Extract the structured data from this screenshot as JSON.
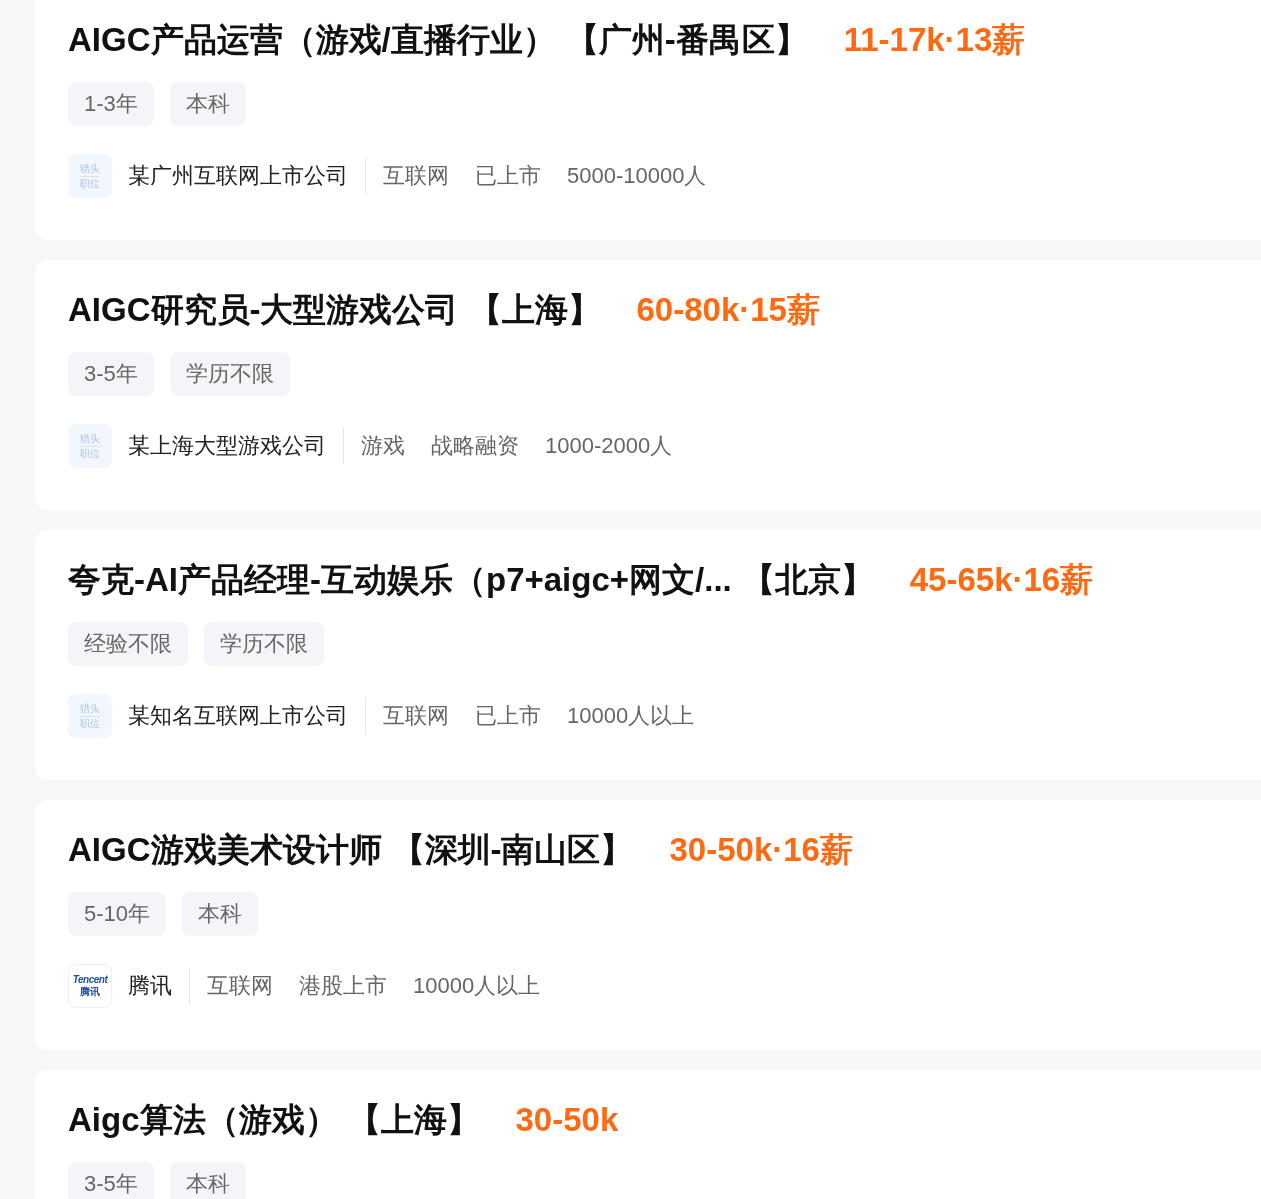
{
  "jobs": [
    {
      "name": "AIGC产品运营（游戏/直播行业）",
      "location": "【广州-番禺区】",
      "salary": "11-17k·13薪",
      "tags": [
        "1-3年",
        "本科"
      ],
      "company": {
        "logo": {
          "kind": "headhunter",
          "lines": [
            "猎头",
            "职位"
          ]
        },
        "name": "某广州互联网上市公司",
        "details": [
          "互联网",
          "已上市",
          "5000-10000人"
        ]
      }
    },
    {
      "name": "AIGC研究员-大型游戏公司",
      "location": "【上海】",
      "salary": "60-80k·15薪",
      "tags": [
        "3-5年",
        "学历不限"
      ],
      "company": {
        "logo": {
          "kind": "headhunter",
          "lines": [
            "猎头",
            "职位"
          ]
        },
        "name": "某上海大型游戏公司",
        "details": [
          "游戏",
          "战略融资",
          "1000-2000人"
        ]
      }
    },
    {
      "name": "夸克-AI产品经理-互动娱乐（p7+aigc+网文/...",
      "location": "【北京】",
      "salary": "45-65k·16薪",
      "tags": [
        "经验不限",
        "学历不限"
      ],
      "company": {
        "logo": {
          "kind": "headhunter",
          "lines": [
            "猎头",
            "职位"
          ]
        },
        "name": "某知名互联网上市公司",
        "details": [
          "互联网",
          "已上市",
          "10000人以上"
        ]
      }
    },
    {
      "name": "AIGC游戏美术设计师",
      "location": "【深圳-南山区】",
      "salary": "30-50k·16薪",
      "tags": [
        "5-10年",
        "本科"
      ],
      "company": {
        "logo": {
          "kind": "brand",
          "lines": [
            "Tencent",
            "腾讯"
          ]
        },
        "name": "腾讯",
        "details": [
          "互联网",
          "港股上市",
          "10000人以上"
        ]
      }
    },
    {
      "name": "Aigc算法（游戏）",
      "location": "【上海】",
      "salary": "30-50k",
      "tags": [
        "3-5年",
        "本科"
      ]
    }
  ]
}
